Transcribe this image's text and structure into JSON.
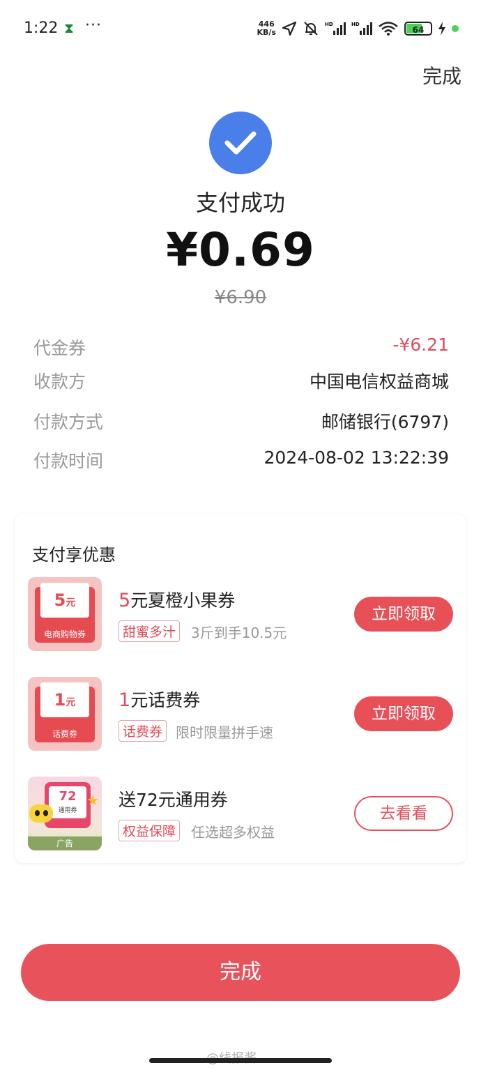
{
  "status_bar": {
    "time": "1:22",
    "carrier_icon": "china-post-icon",
    "more": "···",
    "speed_value": "446",
    "speed_unit": "KB/s",
    "battery": "64"
  },
  "header": {
    "done_label": "完成"
  },
  "result": {
    "title": "支付成功",
    "amount": "¥0.69",
    "original_amount": "¥6.90"
  },
  "details": [
    {
      "label": "代金券",
      "value": "-¥6.21",
      "highlight": true
    },
    {
      "label": "收款方",
      "value": "中国电信权益商城"
    },
    {
      "label": "付款方式",
      "value": "邮储银行(6797)"
    },
    {
      "label": "付款时间",
      "value": "2024-08-02 13:22:39"
    }
  ],
  "promo": {
    "title": "支付享优惠",
    "offers": [
      {
        "thumb_value": "5",
        "thumb_unit": "元",
        "thumb_label": "电商购物券",
        "title_num": "5",
        "title_rest": "元夏橙小果券",
        "tag": "甜蜜多汁",
        "subtitle": "3斤到手10.5元",
        "button": "立即领取"
      },
      {
        "thumb_value": "1",
        "thumb_unit": "元",
        "thumb_label": "话费券",
        "title_num": "1",
        "title_rest": "元话费券",
        "tag": "话费券",
        "subtitle": "限时限量拼手速",
        "button": "立即领取"
      },
      {
        "thumb_value": "72",
        "thumb_unit": "元",
        "thumb_label": "通用券",
        "thumb_ad": "广告",
        "title": "送72元通用券",
        "tag": "权益保障",
        "subtitle": "任选超多权益",
        "button": "去看看"
      }
    ]
  },
  "footer": {
    "done_label": "完成"
  },
  "watermark": "@线报酱",
  "colors": {
    "accent": "#e8535b",
    "check": "#4a7ee8",
    "highlight": "#e24a57"
  }
}
